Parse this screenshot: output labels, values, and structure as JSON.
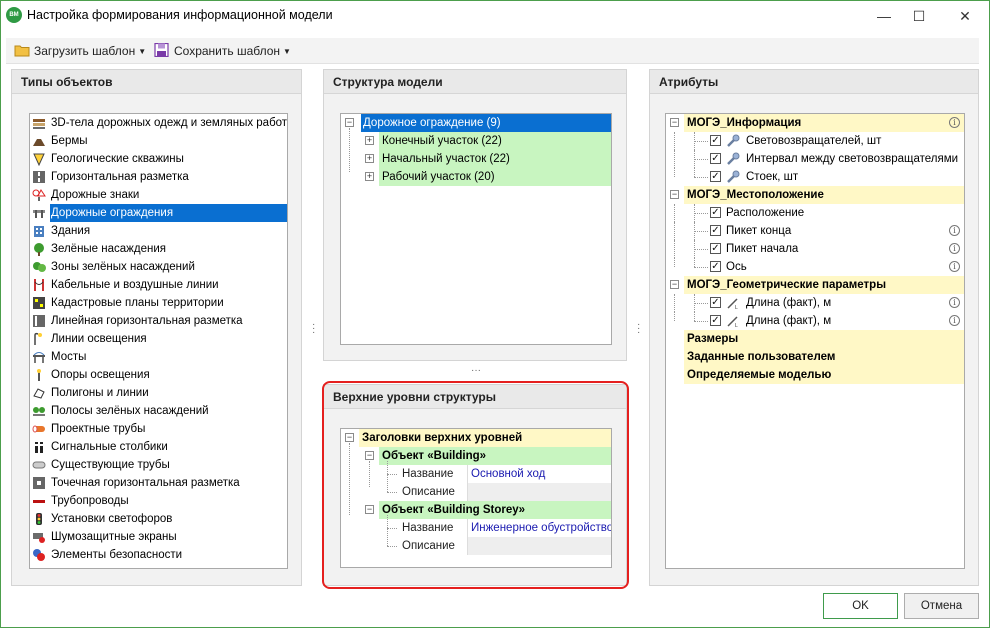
{
  "window": {
    "app_icon_text": "BM",
    "title": "Настройка формирования информационной модели",
    "minimize": "—",
    "maximize": "☐",
    "close": "✕"
  },
  "toolbar": {
    "load_template": "Загрузить шаблон",
    "save_template": "Сохранить шаблон"
  },
  "types_panel": {
    "title": "Типы объектов",
    "items": [
      {
        "label": "3D-тела дорожных одежд и земляных работ",
        "icon": "layers-icon"
      },
      {
        "label": "Бермы",
        "icon": "berm-icon"
      },
      {
        "label": "Геологические скважины",
        "icon": "borehole-icon"
      },
      {
        "label": "Горизонтальная разметка",
        "icon": "road-marking-icon"
      },
      {
        "label": "Дорожные знаки",
        "icon": "road-sign-icon"
      },
      {
        "label": "Дорожные ограждения",
        "icon": "guardrail-icon"
      },
      {
        "label": "Здания",
        "icon": "building-icon"
      },
      {
        "label": "Зелёные насаждения",
        "icon": "tree-icon"
      },
      {
        "label": "Зоны зелёных насаждений",
        "icon": "green-zone-icon"
      },
      {
        "label": "Кабельные и воздушные линии",
        "icon": "cable-icon"
      },
      {
        "label": "Кадастровые планы территории",
        "icon": "cadastral-icon"
      },
      {
        "label": "Линейная горизонтальная разметка",
        "icon": "line-marking-icon"
      },
      {
        "label": "Линии освещения",
        "icon": "lighting-line-icon"
      },
      {
        "label": "Мосты",
        "icon": "bridge-icon"
      },
      {
        "label": "Опоры освещения",
        "icon": "lamp-post-icon"
      },
      {
        "label": "Полигоны и линии",
        "icon": "polygon-icon"
      },
      {
        "label": "Полосы зелёных насаждений",
        "icon": "green-strip-icon"
      },
      {
        "label": "Проектные трубы",
        "icon": "design-pipe-icon"
      },
      {
        "label": "Сигнальные столбики",
        "icon": "signal-post-icon"
      },
      {
        "label": "Существующие трубы",
        "icon": "existing-pipe-icon"
      },
      {
        "label": "Точечная горизонтальная разметка",
        "icon": "point-marking-icon"
      },
      {
        "label": "Трубопроводы",
        "icon": "pipeline-icon"
      },
      {
        "label": "Установки светофоров",
        "icon": "traffic-light-icon"
      },
      {
        "label": "Шумозащитные экраны",
        "icon": "noise-barrier-icon"
      },
      {
        "label": "Элементы безопасности",
        "icon": "safety-icon"
      }
    ],
    "selected_index": 5
  },
  "structure_panel": {
    "title": "Структура модели",
    "root": "Дорожное ограждение (9)",
    "children": [
      "Конечный участок (22)",
      "Начальный участок (22)",
      "Рабочий участок (20)"
    ]
  },
  "top_levels_panel": {
    "title": "Верхние уровни структуры",
    "root": "Заголовки верхних уровней",
    "objects": [
      {
        "title": "Объект «Building»",
        "name_label": "Название",
        "name_value": "Основной ход",
        "desc_label": "Описание",
        "desc_value": ""
      },
      {
        "title": "Объект «Building Storey»",
        "name_label": "Название",
        "name_value": "Инженерное обустройство",
        "desc_label": "Описание",
        "desc_value": ""
      }
    ]
  },
  "attributes_panel": {
    "title": "Атрибуты",
    "groups": [
      {
        "title": "МОГЭ_Информация",
        "info": true,
        "items": [
          {
            "label": "Световозвращателей, шт",
            "checked": true,
            "icon": "wrench-icon",
            "info": false
          },
          {
            "label": "Интервал между световозвращателями",
            "checked": true,
            "icon": "wrench-icon",
            "info": false
          },
          {
            "label": "Стоек, шт",
            "checked": true,
            "icon": "wrench-icon",
            "info": false
          }
        ]
      },
      {
        "title": "МОГЭ_Местоположение",
        "info": false,
        "items": [
          {
            "label": "Расположение",
            "checked": true,
            "icon": "",
            "info": false
          },
          {
            "label": "Пикет конца",
            "checked": true,
            "icon": "",
            "info": true
          },
          {
            "label": "Пикет начала",
            "checked": true,
            "icon": "",
            "info": true
          },
          {
            "label": "Ось",
            "checked": true,
            "icon": "",
            "info": true
          }
        ]
      },
      {
        "title": "МОГЭ_Геометрические параметры",
        "info": false,
        "items": [
          {
            "label": "Длина (факт), м",
            "checked": true,
            "icon": "length-icon",
            "info": true
          },
          {
            "label": "Длина (факт), м",
            "checked": true,
            "icon": "length-icon",
            "info": true
          }
        ]
      }
    ],
    "flat_groups": [
      "Размеры",
      "Заданные пользователем",
      "Определяемые моделью"
    ]
  },
  "footer": {
    "ok": "OK",
    "cancel": "Отмена"
  },
  "colors": {
    "selection": "#0a6fd1",
    "green_row": "#c8f5c0",
    "yellow_row": "#fff8c6",
    "highlight_border": "#e5201f"
  }
}
